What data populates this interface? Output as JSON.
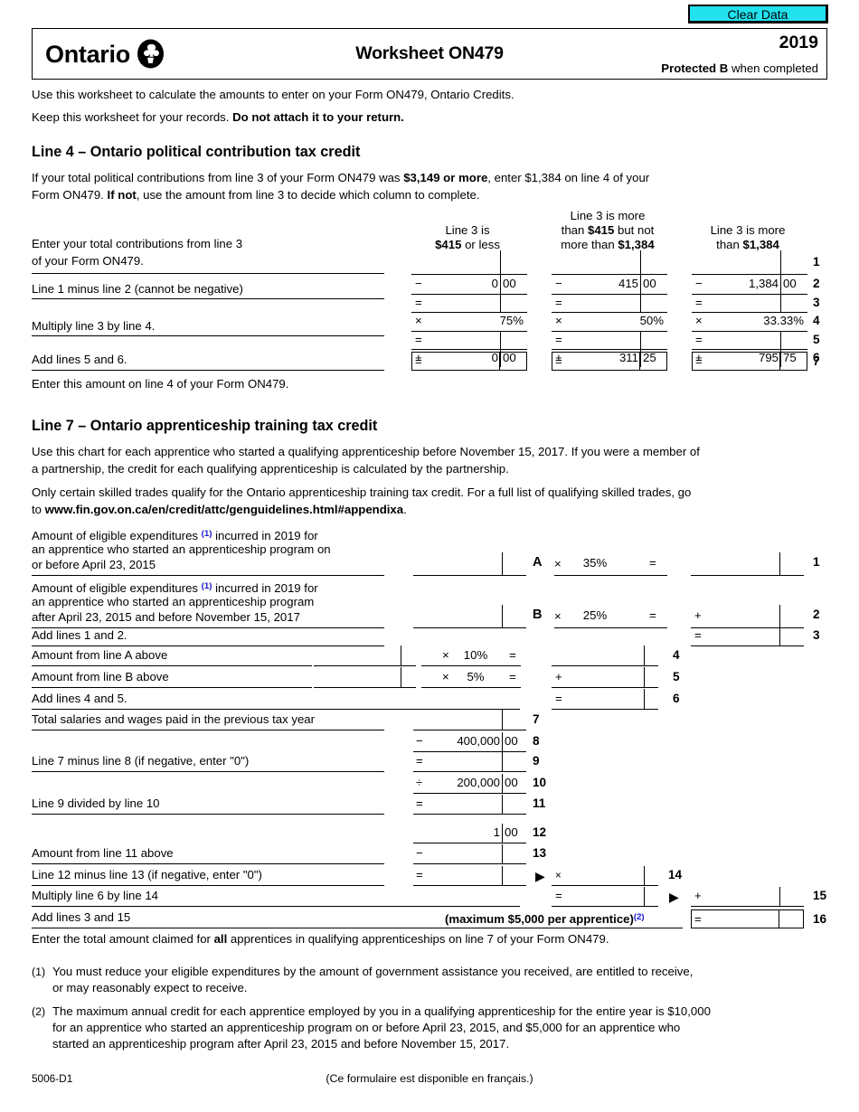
{
  "buttons": {
    "clear_data": "Clear Data"
  },
  "header": {
    "province": "Ontario",
    "title": "Worksheet ON479",
    "year": "2019",
    "protected_bold": "Protected B",
    "protected_rest": " when completed"
  },
  "intro": {
    "line1": "Use this worksheet to calculate the amounts to enter on your Form ON479, Ontario Credits.",
    "line2_a": "Keep this worksheet for your records. ",
    "line2_b": "Do not attach it to your return."
  },
  "line4": {
    "heading": "Line 4 – Ontario political contribution tax credit",
    "para_a": "If your total political contributions from line 3 of your Form ON479 was ",
    "para_b": "$3,149 or more",
    "para_c": ", enter $1,384 on line 4 of your",
    "para_d": "Form ON479. ",
    "para_e": "If not",
    "para_f": ", use the amount from line 3 to decide which column to complete.",
    "col_headers": [
      {
        "l1": "",
        "l2a": "Line 3 is",
        "l2b": "",
        "l3a": "",
        "l3b": "$415",
        "l3c": " or less"
      },
      {
        "l1": "Line 3 is more",
        "l2a": "than ",
        "l2b": "$415",
        "l2c": " but not",
        "l3a": "more than ",
        "l3b": "$1,384"
      },
      {
        "l1": "",
        "l2a": "Line 3 is more",
        "l3a": "than ",
        "l3b": "$1,384"
      }
    ],
    "labels": {
      "row1a": "Enter your total contributions from line 3",
      "row1b": "of your Form ON479.",
      "row3": "Line 1 minus line 2 (cannot be negative)",
      "row5": "Multiply line 3 by line 4.",
      "row7": "Add lines 5 and 6.",
      "closing": "Enter this amount on line 4 of your Form ON479."
    },
    "rows": [
      {
        "no": "1",
        "op": "",
        "cols": [
          {
            "d": "",
            "c": ""
          },
          {
            "d": "",
            "c": ""
          },
          {
            "d": "",
            "c": ""
          }
        ]
      },
      {
        "no": "2",
        "op": "−",
        "cols": [
          {
            "d": "0",
            "c": "00"
          },
          {
            "d": "415",
            "c": "00"
          },
          {
            "d": "1,384",
            "c": "00"
          }
        ]
      },
      {
        "no": "3",
        "op": "=",
        "cols": [
          {
            "d": "",
            "c": ""
          },
          {
            "d": "",
            "c": ""
          },
          {
            "d": "",
            "c": ""
          }
        ]
      },
      {
        "no": "4",
        "op": "×",
        "cols": [
          {
            "d": "75%",
            "c": ""
          },
          {
            "d": "50%",
            "c": ""
          },
          {
            "d": "33.33%",
            "c": ""
          }
        ]
      },
      {
        "no": "5",
        "op": "=",
        "cols": [
          {
            "d": "",
            "c": ""
          },
          {
            "d": "",
            "c": ""
          },
          {
            "d": "",
            "c": ""
          }
        ]
      },
      {
        "no": "6",
        "op": "+",
        "cols": [
          {
            "d": "0",
            "c": "00"
          },
          {
            "d": "311",
            "c": "25"
          },
          {
            "d": "795",
            "c": "75"
          }
        ]
      },
      {
        "no": "7",
        "op": "=",
        "cols": [
          {
            "d": "",
            "c": ""
          },
          {
            "d": "",
            "c": ""
          },
          {
            "d": "",
            "c": ""
          }
        ]
      }
    ]
  },
  "line7": {
    "heading": "Line 7 – Ontario apprenticeship training tax credit",
    "para1_l1": "Use this chart for each apprentice who started a qualifying apprenticeship before November 15, 2017. If you were a member of",
    "para1_l2": "a partnership, the credit for each qualifying apprenticeship is calculated by the partnership.",
    "para2_l1": "Only certain skilled trades qualify for the Ontario apprenticeship training tax credit. For a full list of qualifying skilled trades, go",
    "para2_l2a": "to ",
    "para2_l2b": "www.fin.gov.on.ca/en/credit/attc/genguidelines.html#appendixa",
    "para2_l2c": ".",
    "rowA": {
      "l1a": "Amount of eligible expenditures ",
      "l1_fn": "(1)",
      "l1b": " incurred in 2019 for",
      "l2": "an apprentice who started an apprenticeship program on",
      "l3": "or before April 23, 2015",
      "letter": "A",
      "mult": "×",
      "rate": "35%",
      "eq": "=",
      "no": "1"
    },
    "rowB": {
      "l1a": "Amount of eligible expenditures ",
      "l1_fn": "(1)",
      "l1b": " incurred in 2019 for",
      "l2": "an apprentice who started an apprenticeship program",
      "l3": "after April 23, 2015 and before November 15, 2017",
      "letter": "B",
      "mult": "×",
      "rate": "25%",
      "eq": "=",
      "plus": "+",
      "no": "2"
    },
    "row3": {
      "label": "Add lines 1 and 2.",
      "op": "=",
      "no": "3"
    },
    "row4": {
      "label": "Amount from line A above",
      "mult": "×",
      "rate": "10%",
      "eq": "=",
      "no": "4"
    },
    "row5": {
      "label": "Amount from line B above",
      "mult": "×",
      "rate": "5%",
      "eq": "=",
      "plus": "+",
      "no": "5"
    },
    "row6": {
      "label": "Add lines 4 and 5.",
      "op": "=",
      "no": "6"
    },
    "row7": {
      "label": "Total salaries and wages paid in the previous tax year",
      "no": "7"
    },
    "row8": {
      "op": "−",
      "dollars": "400,000",
      "cents": "00",
      "no": "8"
    },
    "row9": {
      "label": "Line 7 minus line 8 (if negative, enter \"0\")",
      "op": "=",
      "no": "9"
    },
    "row10": {
      "op": "÷",
      "dollars": "200,000",
      "cents": "00",
      "no": "10"
    },
    "row11": {
      "label": "Line 9 divided by line 10",
      "op": "=",
      "no": "11"
    },
    "row12": {
      "dollars": "1",
      "cents": "00",
      "no": "12"
    },
    "row13": {
      "label": "Amount from line 11 above",
      "op": "−",
      "no": "13"
    },
    "row14": {
      "label": "Line 12 minus line 13 (if negative, enter \"0\")",
      "op": "=",
      "mult": "×",
      "no": "14"
    },
    "row15": {
      "label": "Multiply line 6 by line 14",
      "op": "=",
      "plus": "+",
      "no": "15"
    },
    "row16": {
      "label": "Add lines 3 and 15",
      "max_note": "(maximum $5,000 per apprentice)",
      "max_fn": "(2)",
      "op": "=",
      "no": "16"
    },
    "closing_a": "Enter the total amount claimed for ",
    "closing_b": "all",
    "closing_c": " apprentices in qualifying apprenticeships on line 7 of your Form ON479."
  },
  "footnotes": [
    {
      "mark": "(1)",
      "l1": "You must reduce your eligible expenditures by the amount of government assistance you received, are entitled to receive,",
      "l2": "or may reasonably expect to receive."
    },
    {
      "mark": "(2)",
      "l1": "The maximum annual credit for each apprentice employed by you in a qualifying apprenticeship for the entire year is $10,000",
      "l2": "for an apprentice who started an apprenticeship program on or before April 23, 2015, and $5,000 for an apprentice who",
      "l3": "started an apprenticeship program after April 23, 2015 and before November 15, 2017."
    }
  ],
  "footer": {
    "form_code": "5006-D1",
    "french_note": "(Ce formulaire est disponible en français.)"
  },
  "colors": {
    "clear_data_bg": "#22e2ee",
    "footnote_mark": "#1414d2",
    "ink": "#000000"
  }
}
